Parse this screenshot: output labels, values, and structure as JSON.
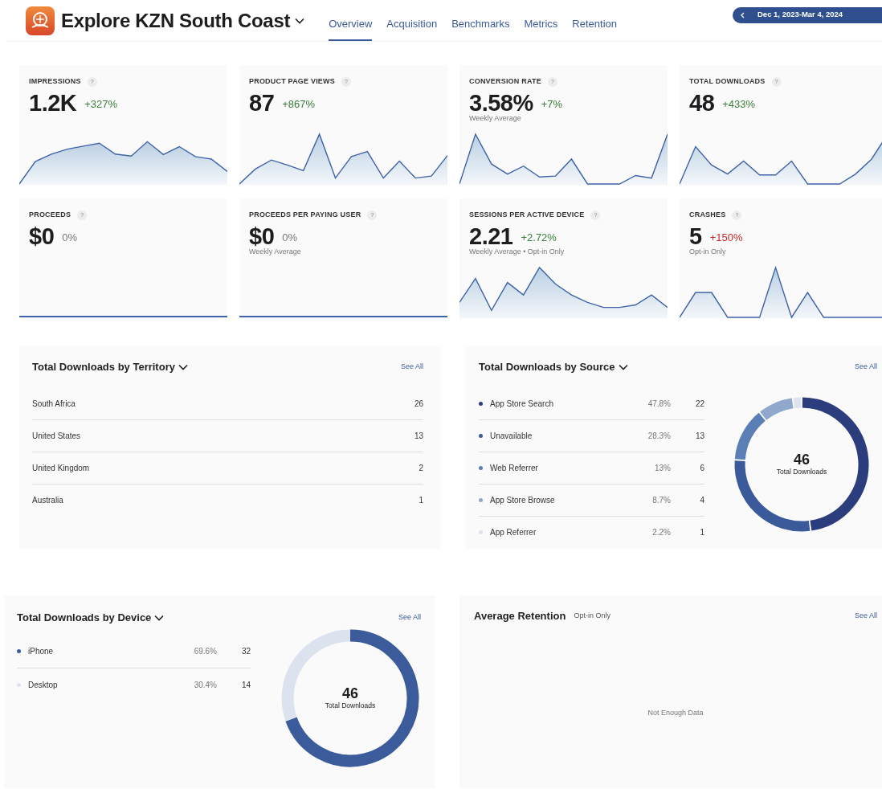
{
  "app": {
    "title": "Explore KZN South Coast"
  },
  "tabs": [
    {
      "label": "Overview",
      "selected": true
    },
    {
      "label": "Acquisition",
      "selected": false
    },
    {
      "label": "Benchmarks",
      "selected": false
    },
    {
      "label": "Metrics",
      "selected": false
    },
    {
      "label": "Retention",
      "selected": false
    }
  ],
  "date_range": {
    "label": "Dec 1, 2023-Mar 4, 2024"
  },
  "metrics": [
    {
      "label": "IMPRESSIONS",
      "help": "?",
      "value": "1.2K",
      "change": "+327%",
      "color": "#3a7d3a"
    },
    {
      "label": "PRODUCT PAGE VIEWS",
      "help": "?",
      "value": "87",
      "change": "+867%",
      "color": "#3a7d3a"
    },
    {
      "label": "CONVERSION RATE",
      "help": "?",
      "value": "3.58%",
      "change": "+7%",
      "color": "#3a7d3a",
      "note": "Weekly Average"
    },
    {
      "label": "TOTAL DOWNLOADS",
      "help": "?",
      "value": "48",
      "change": "+433%",
      "color": "#3a7d3a"
    },
    {
      "label": "PROCEEDS",
      "help": "?",
      "value": "$0",
      "change": "0%",
      "color": "#777777"
    },
    {
      "label": "PROCEEDS PER PAYING USER",
      "help": "?",
      "value": "$0",
      "change": "0%",
      "color": "#777777",
      "note": "Weekly Average"
    },
    {
      "label": "SESSIONS PER ACTIVE DEVICE",
      "help": "?",
      "value": "2.21",
      "change": "+2.72%",
      "color": "#3a7d3a",
      "note": "Weekly Average • Opt-in Only"
    },
    {
      "label": "CRASHES",
      "help": "?",
      "value": "5",
      "change": "+150%",
      "color": "#c62828",
      "note": "Opt-in Only"
    }
  ],
  "territory": {
    "title": "Total Downloads by Territory",
    "see_all": "See All",
    "rows": [
      {
        "name": "South Africa",
        "count": "26"
      },
      {
        "name": "United States",
        "count": "13"
      },
      {
        "name": "United Kingdom",
        "count": "2"
      },
      {
        "name": "Australia",
        "count": "1"
      }
    ]
  },
  "source": {
    "title": "Total Downloads by Source",
    "see_all": "See All",
    "total": "46",
    "total_label": "Total Downloads",
    "items": [
      {
        "name": "App Store Search",
        "share": "47.8%",
        "count": "22",
        "color": "#2c3d7d"
      },
      {
        "name": "Unavailable",
        "share": "28.3%",
        "count": "13",
        "color": "#3a5a9a"
      },
      {
        "name": "Web Referrer",
        "share": "13%",
        "count": "6",
        "color": "#5b7fb5"
      },
      {
        "name": "App Store Browse",
        "share": "8.7%",
        "count": "4",
        "color": "#8fa8cc"
      },
      {
        "name": "App Referrer",
        "share": "2.2%",
        "count": "1",
        "color": "#dde3ee"
      }
    ]
  },
  "device": {
    "title": "Total Downloads by Device",
    "see_all": "See All",
    "total": "46",
    "total_label": "Total Downloads",
    "items": [
      {
        "name": "iPhone",
        "share": "69.6%",
        "count": "32",
        "color": "#3b5b9b"
      },
      {
        "name": "Desktop",
        "share": "30.4%",
        "count": "14",
        "color": "#dde3ee"
      }
    ]
  },
  "retention": {
    "title": "Average Retention",
    "note": "Opt-in Only",
    "see_all": "See All",
    "empty_message": "Not Enough Data"
  }
}
